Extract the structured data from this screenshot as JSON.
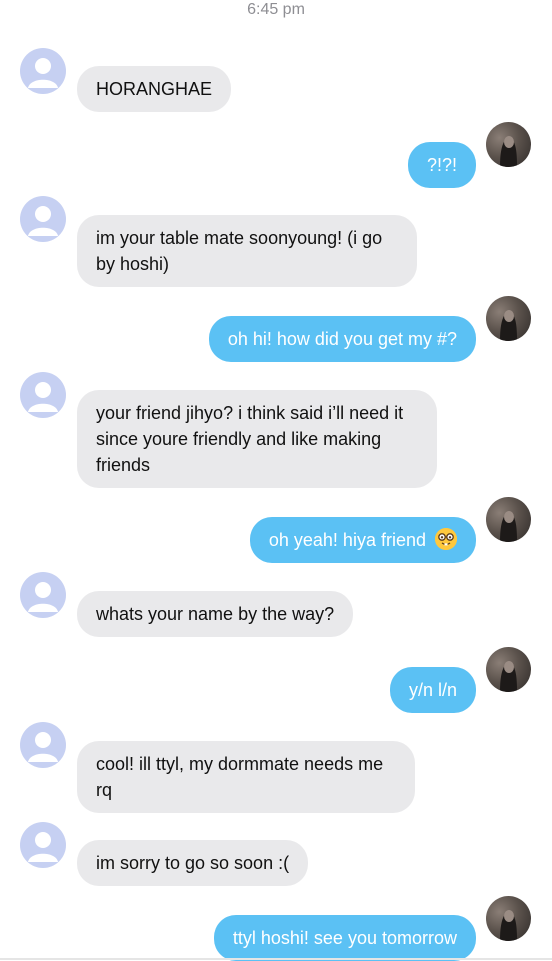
{
  "timestamp": "6:45 pm",
  "colors": {
    "incoming_bubble": "#e9e9eb",
    "outgoing_bubble": "#5bc1f4",
    "default_avatar": "#c6d0f2"
  },
  "messages": [
    {
      "sender": "contact",
      "text": "HORANGHAE"
    },
    {
      "sender": "me",
      "text": "?!?!"
    },
    {
      "sender": "contact",
      "text": "im your table mate soonyoung! (i go by hoshi)"
    },
    {
      "sender": "me",
      "text": "oh hi! how did you get my #?"
    },
    {
      "sender": "contact",
      "text": "your friend jihyo? i think said i’ll need it since youre friendly and like making friends"
    },
    {
      "sender": "me",
      "text": "oh yeah! hiya friend",
      "emoji": "nerd-face-emoji"
    },
    {
      "sender": "contact",
      "text": "whats your name by the way?"
    },
    {
      "sender": "me",
      "text": "y/n l/n"
    },
    {
      "sender": "contact",
      "text": "cool! ill ttyl, my dormmate needs me rq"
    },
    {
      "sender": "contact",
      "text": "im sorry to go so soon :("
    },
    {
      "sender": "me",
      "text": "ttyl hoshi! see you tomorrow"
    }
  ]
}
